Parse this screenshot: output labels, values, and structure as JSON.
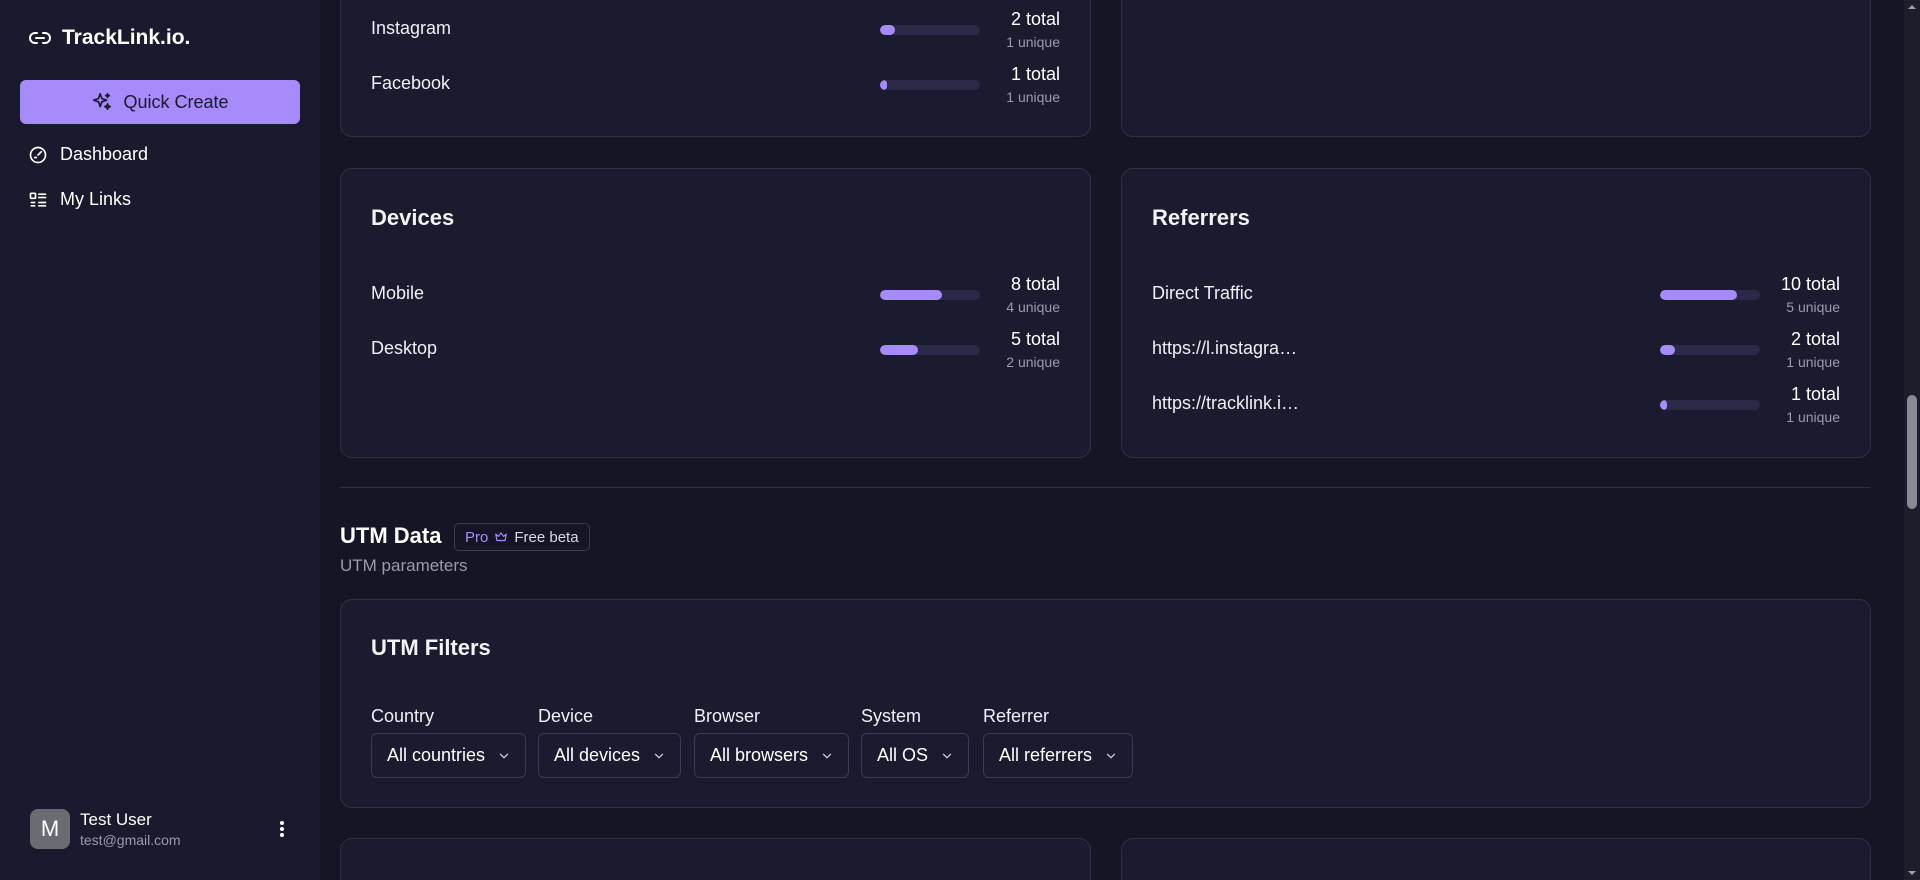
{
  "brand": {
    "name": "TrackLink.io."
  },
  "sidebar": {
    "quick_create": "Quick Create",
    "items": [
      {
        "label": "Dashboard"
      },
      {
        "label": "My Links"
      }
    ]
  },
  "user": {
    "initial": "M",
    "name": "Test User",
    "email": "test@gmail.com"
  },
  "social_card": {
    "rows": [
      {
        "label": "Instagram",
        "total": "2 total",
        "unique": "1 unique",
        "fill": 0.15
      },
      {
        "label": "Facebook",
        "total": "1 total",
        "unique": "1 unique",
        "fill": 0.07
      }
    ]
  },
  "devices_card": {
    "title": "Devices",
    "rows": [
      {
        "label": "Mobile",
        "total": "8 total",
        "unique": "4 unique",
        "fill": 0.62
      },
      {
        "label": "Desktop",
        "total": "5 total",
        "unique": "2 unique",
        "fill": 0.38
      }
    ]
  },
  "referrers_card": {
    "title": "Referrers",
    "rows": [
      {
        "label": "https://l.instagra…",
        "total": "2 total",
        "unique": "1 unique",
        "fill": 0.15
      },
      {
        "label": "https://tracklink.i…",
        "total": "1 total",
        "unique": "1 unique",
        "fill": 0.07
      }
    ],
    "direct": {
      "label": "Direct Traffic",
      "total": "10 total",
      "unique": "5 unique",
      "fill": 0.77
    }
  },
  "utm": {
    "title": "UTM Data",
    "badge_pro": "Pro",
    "badge_text": "Free beta",
    "subtitle": "UTM parameters",
    "filters_title": "UTM Filters",
    "filters": [
      {
        "label": "Country",
        "value": "All countries"
      },
      {
        "label": "Device",
        "value": "All devices"
      },
      {
        "label": "Browser",
        "value": "All browsers"
      },
      {
        "label": "System",
        "value": "All OS"
      },
      {
        "label": "Referrer",
        "value": "All referrers"
      }
    ]
  },
  "colors": {
    "accent": "#a78bfa",
    "background": "#151526",
    "sidebar": "#1a1a2e",
    "card": "#1b1b2f"
  }
}
